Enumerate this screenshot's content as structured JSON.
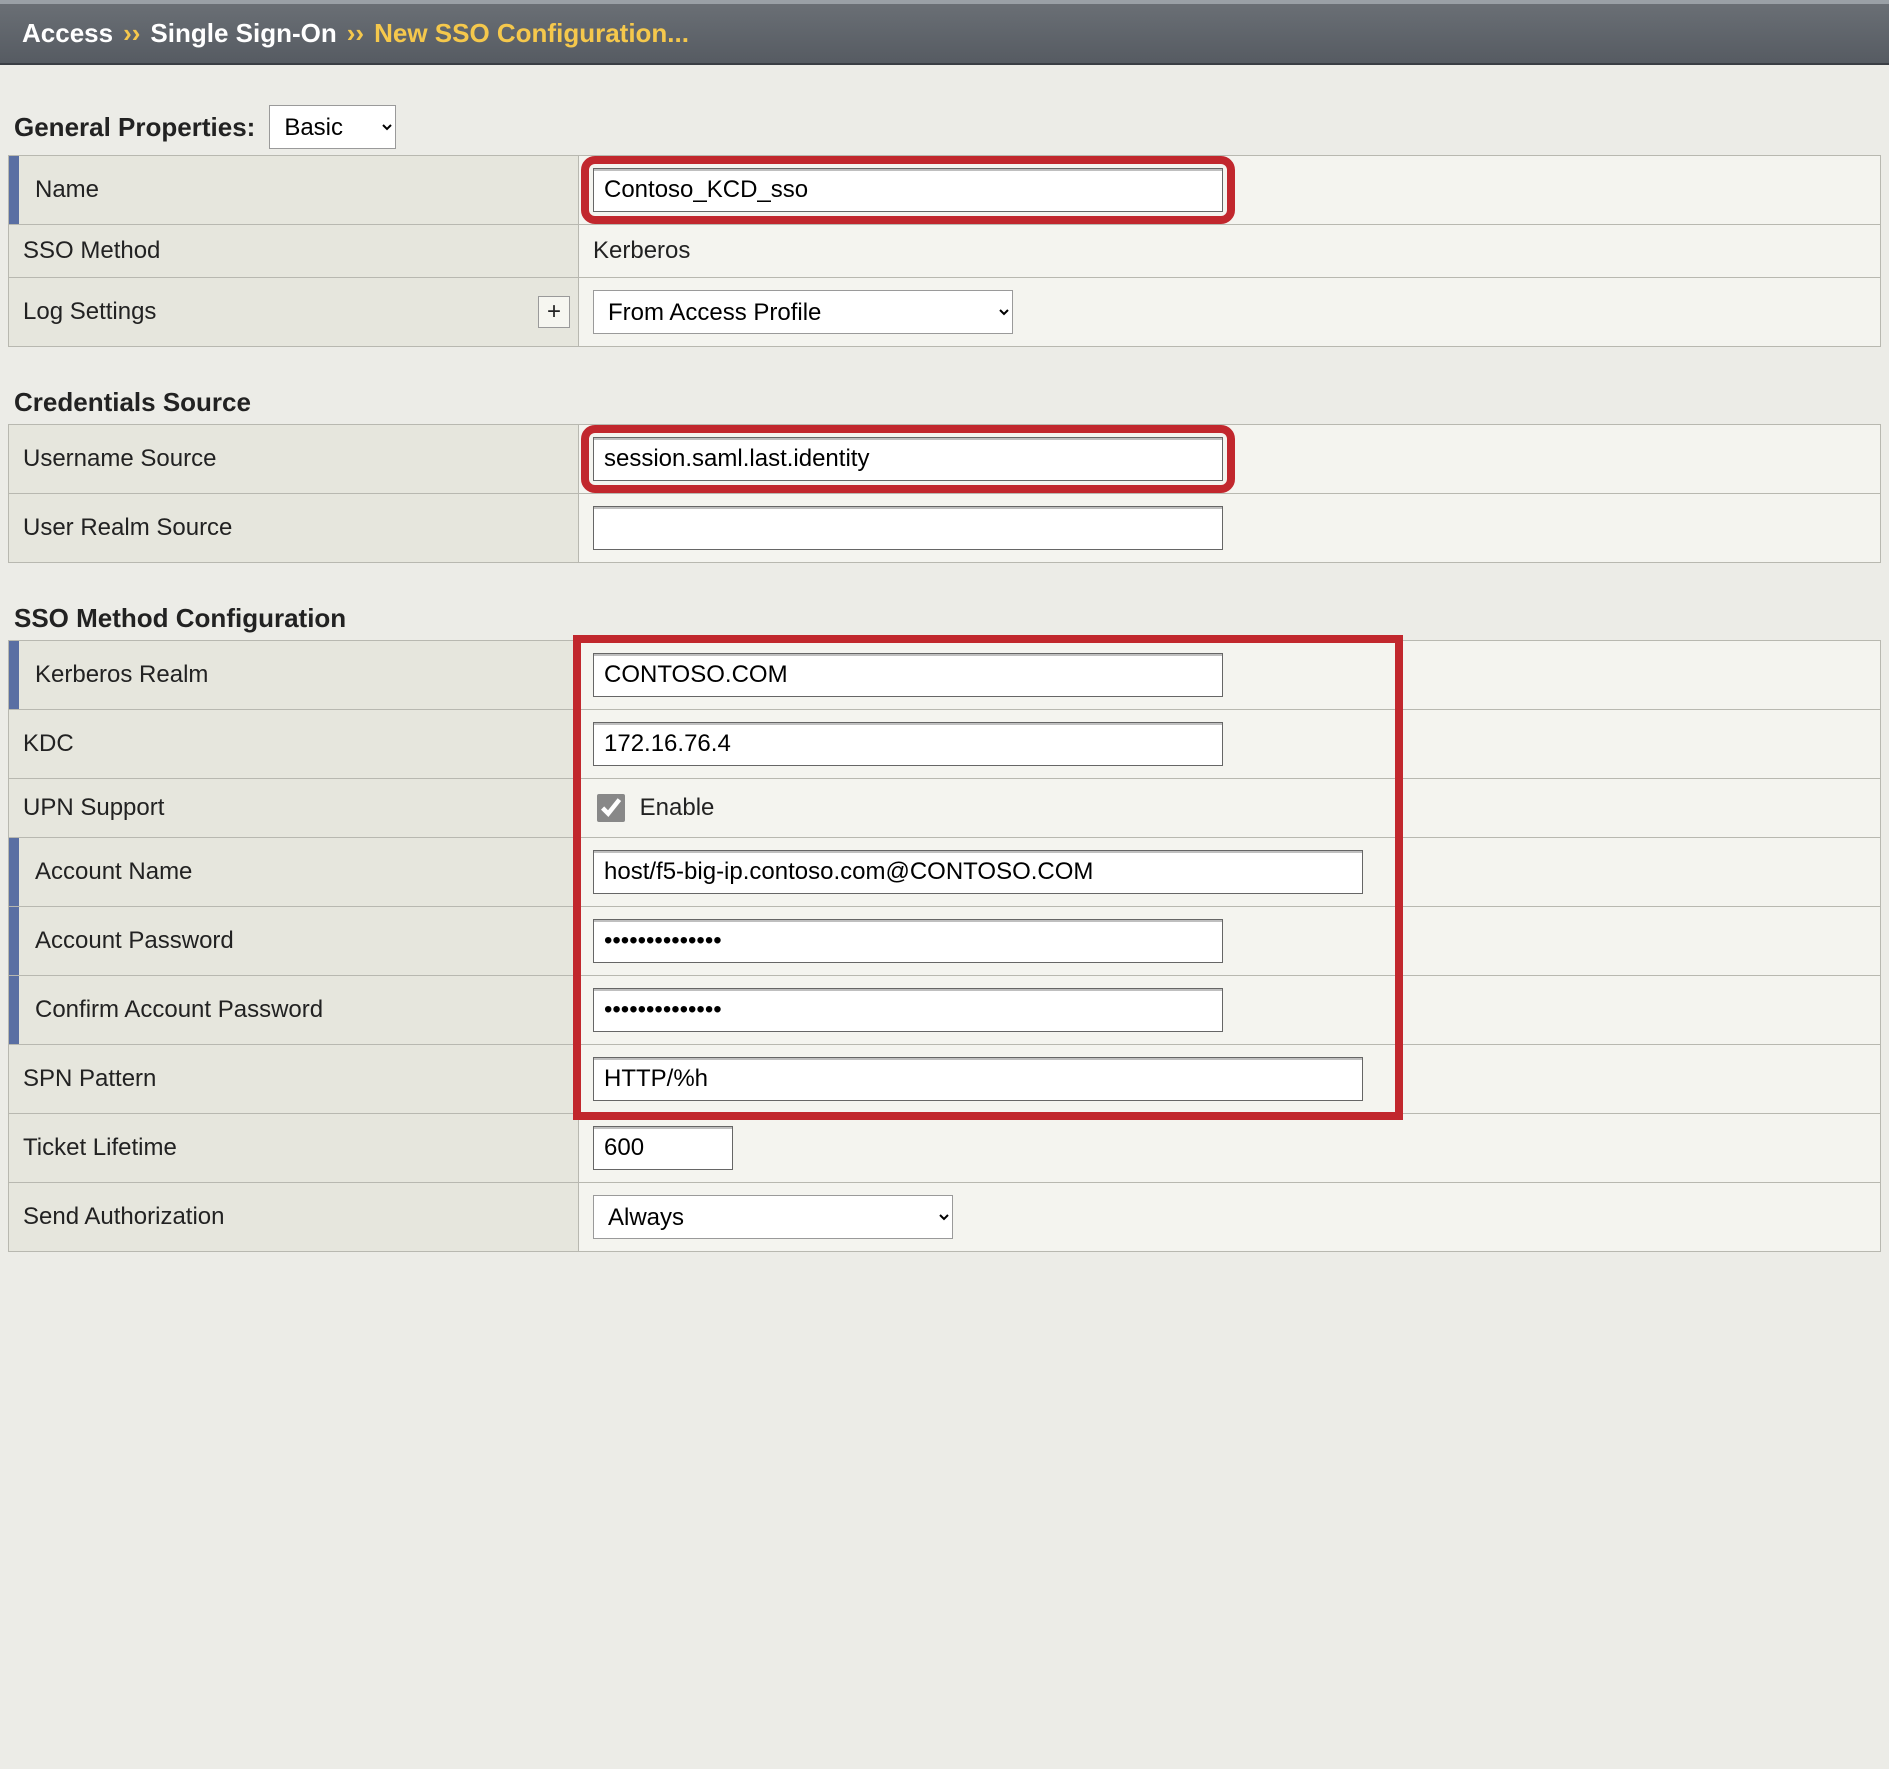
{
  "breadcrumb": {
    "access": "Access",
    "sso": "Single Sign-On",
    "current": "New SSO Configuration..."
  },
  "sections": {
    "general": {
      "title": "General Properties:",
      "mode": "Basic",
      "name_label": "Name",
      "name_value": "Contoso_KCD_sso",
      "method_label": "SSO Method",
      "method_value": "Kerberos",
      "log_label": "Log Settings",
      "plus_label": "+",
      "log_value": "From Access Profile"
    },
    "creds": {
      "title": "Credentials Source",
      "user_src_label": "Username Source",
      "user_src_value": "session.saml.last.identity",
      "realm_src_label": "User Realm Source",
      "realm_src_value": ""
    },
    "method": {
      "title": "SSO Method Configuration",
      "realm_label": "Kerberos Realm",
      "realm_value": "CONTOSO.COM",
      "kdc_label": "KDC",
      "kdc_value": "172.16.76.4",
      "upn_label": "UPN Support",
      "upn_enable": "Enable",
      "acct_name_label": "Account Name",
      "acct_name_value": "host/f5-big-ip.contoso.com@CONTOSO.COM",
      "acct_pw_label": "Account Password",
      "acct_pw_value": "••••••••••••••",
      "acct_pw2_label": "Confirm Account Password",
      "acct_pw2_value": "••••••••••••••",
      "spn_label": "SPN Pattern",
      "spn_value": "HTTP/%h",
      "ticket_label": "Ticket Lifetime",
      "ticket_value": "600",
      "sendauth_label": "Send Authorization",
      "sendauth_value": "Always"
    }
  }
}
